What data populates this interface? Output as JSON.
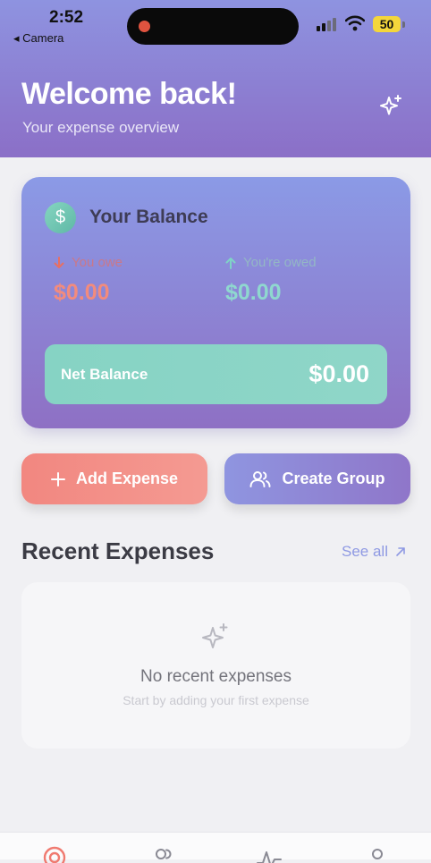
{
  "status": {
    "time": "2:52",
    "back_label": "◂ Camera",
    "battery": "50"
  },
  "header": {
    "title": "Welcome back!",
    "subtitle": "Your expense overview",
    "action_icon": "sparkles-icon"
  },
  "balance_card": {
    "title": "Your Balance",
    "you_owe_label": "You owe",
    "you_owe_value": "$0.00",
    "youre_owed_label": "You're owed",
    "youre_owed_value": "$0.00",
    "net_label": "Net Balance",
    "net_value": "$0.00"
  },
  "actions": {
    "add_label": "Add Expense",
    "group_label": "Create Group"
  },
  "recent": {
    "title": "Recent Expenses",
    "see_all": "See all",
    "empty_title": "No recent expenses",
    "empty_subtitle": "Start by adding your first expense"
  },
  "colors": {
    "accent": "#8e93e0",
    "danger": "#f28780",
    "positive": "#86d3c4"
  }
}
